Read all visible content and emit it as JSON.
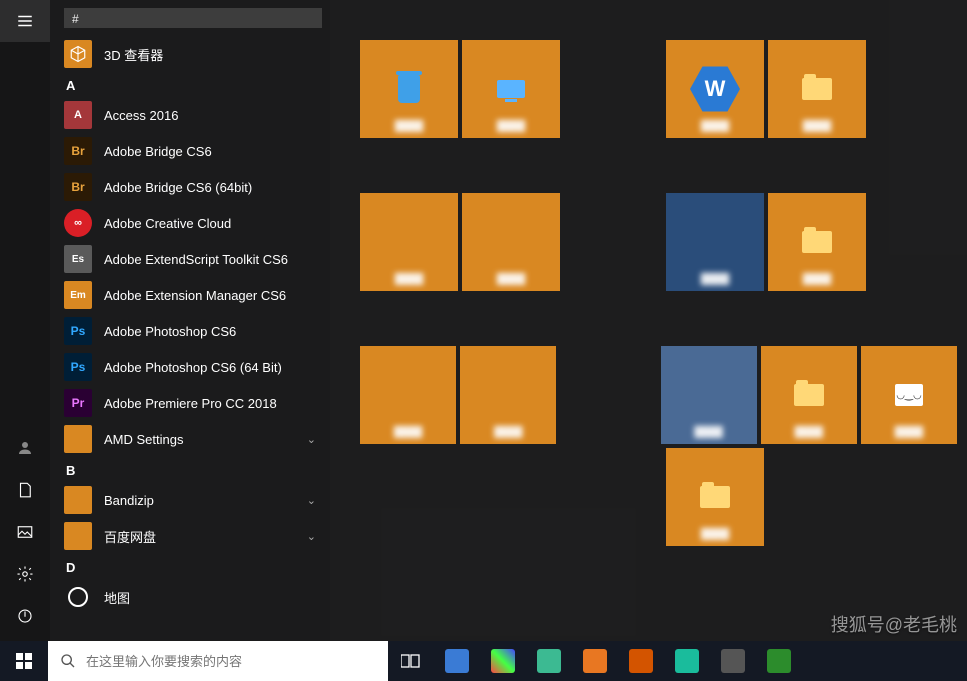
{
  "search_hint_header": "#",
  "letters": {
    "hash": "#",
    "a": "A",
    "b": "B",
    "d": "D"
  },
  "apps": {
    "viewer3d": "3D 查看器",
    "access": "Access 2016",
    "bridge": "Adobe Bridge CS6",
    "bridge64": "Adobe Bridge CS6 (64bit)",
    "cc": "Adobe Creative Cloud",
    "estk": "Adobe ExtendScript Toolkit CS6",
    "ext": "Adobe Extension Manager CS6",
    "ps": "Adobe Photoshop CS6",
    "ps64": "Adobe Photoshop CS6 (64 Bit)",
    "pr": "Adobe Premiere Pro CC 2018",
    "amd": "AMD Settings",
    "bandizip": "Bandizip",
    "baidu": "百度网盘",
    "ditu": "地图"
  },
  "icon_labels": {
    "br": "Br",
    "ps": "Ps",
    "pr": "Pr",
    "access": "A",
    "cc": "∞",
    "em": "Em",
    "es": "Es"
  },
  "chevron": "⌄",
  "search_placeholder": "在这里输入你要搜索的内容",
  "watermark": "搜狐号@老毛桃",
  "tiles": {
    "blur_label": "████"
  },
  "wps_letter": "W",
  "face": "◡‿◡"
}
